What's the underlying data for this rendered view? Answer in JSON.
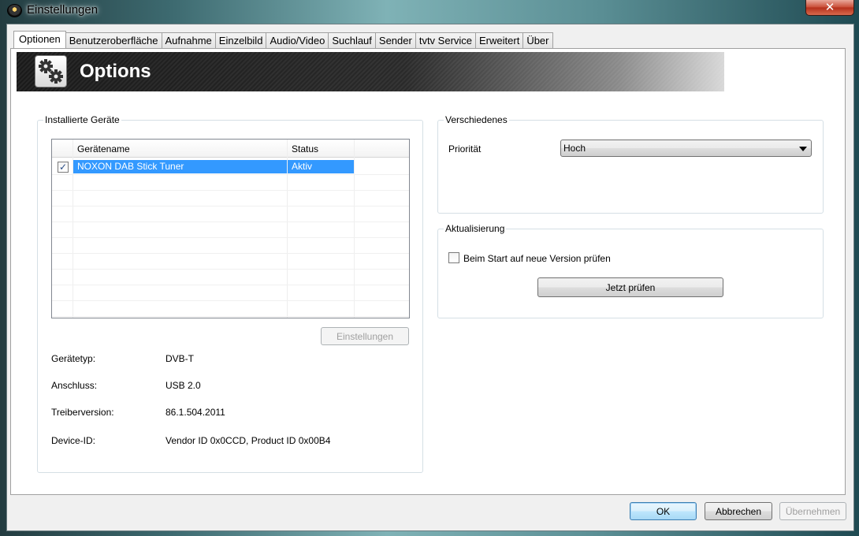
{
  "window": {
    "title": "Einstellungen",
    "close_glyph": "✕"
  },
  "tabs": [
    {
      "label": "Optionen",
      "active": true
    },
    {
      "label": "Benutzeroberfläche"
    },
    {
      "label": "Aufnahme"
    },
    {
      "label": "Einzelbild"
    },
    {
      "label": "Audio/Video"
    },
    {
      "label": "Suchlauf"
    },
    {
      "label": "Sender"
    },
    {
      "label": "tvtv Service"
    },
    {
      "label": "Erweitert"
    },
    {
      "label": "Über"
    }
  ],
  "banner": {
    "title": "Options",
    "icon": "gears-icon"
  },
  "devices": {
    "group_label": "Installierte Geräte",
    "columns": [
      "Gerätename",
      "Status"
    ],
    "rows": [
      {
        "checked": true,
        "name": "NOXON DAB Stick Tuner",
        "status": "Aktiv"
      }
    ],
    "settings_button": "Einstellungen",
    "info": [
      {
        "label": "Gerätetyp:",
        "value": "DVB-T"
      },
      {
        "label": "Anschluss:",
        "value": "USB 2.0"
      },
      {
        "label": "Treiberversion:",
        "value": "86.1.504.2011"
      },
      {
        "label": "Device-ID:",
        "value": "Vendor ID 0x0CCD, Product ID 0x00B4"
      }
    ]
  },
  "misc": {
    "group_label": "Verschiedenes",
    "priority_label": "Priorität",
    "priority_value": "Hoch"
  },
  "update": {
    "group_label": "Aktualisierung",
    "check_label": "Beim Start auf neue Version prüfen",
    "checked": false,
    "check_now": "Jetzt prüfen"
  },
  "footer": {
    "ok": "OK",
    "cancel": "Abbrechen",
    "apply": "Übernehmen"
  },
  "colors": {
    "selection": "#3399ff",
    "close": "#c84a33"
  }
}
